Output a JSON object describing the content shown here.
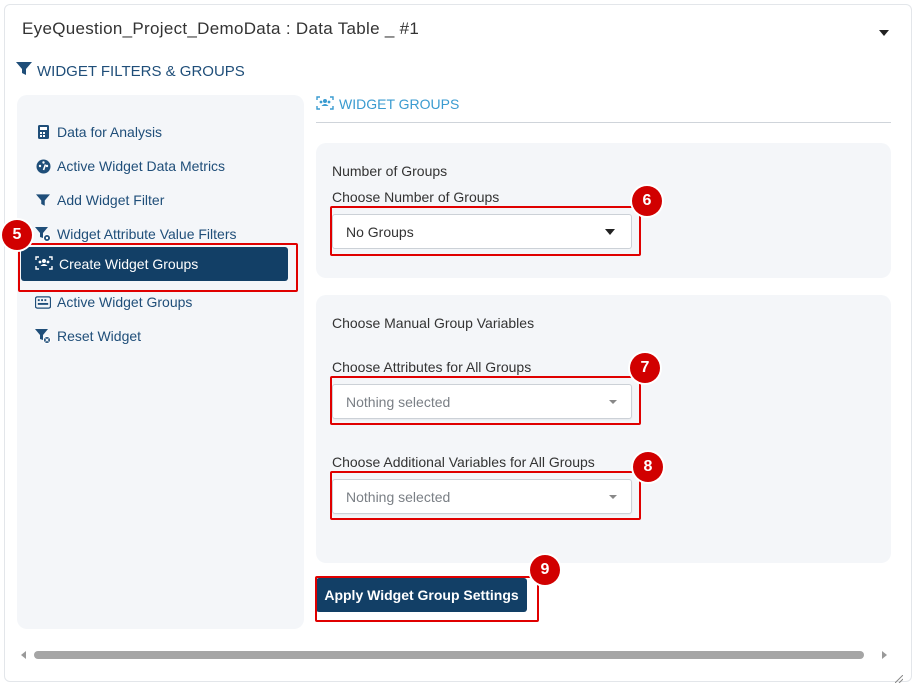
{
  "panel": {
    "title": "EyeQuestion_Project_DemoData : Data Table _ #1"
  },
  "filters_section": {
    "heading": "WIDGET FILTERS & GROUPS",
    "icon": "filter-icon"
  },
  "sidebar": {
    "items": [
      {
        "label": "Data for Analysis",
        "icon": "calculator-icon"
      },
      {
        "label": "Active Widget Data Metrics",
        "icon": "gauge-icon"
      },
      {
        "label": "Add Widget Filter",
        "icon": "filter-icon"
      },
      {
        "label": "Widget Attribute Value Filters",
        "icon": "filter-gear-icon"
      },
      {
        "label": "Create Widget Groups",
        "icon": "users-icon",
        "active": true
      },
      {
        "label": "Active Widget Groups",
        "icon": "keyboard-icon"
      },
      {
        "label": "Reset Widget",
        "icon": "filter-reset-icon"
      }
    ]
  },
  "groups_tab": {
    "label": "WIDGET GROUPS",
    "icon": "users-icon"
  },
  "number_of_groups": {
    "title": "Number of Groups",
    "field_label": "Choose Number of Groups",
    "value": "No Groups"
  },
  "manual_groups": {
    "title": "Choose Manual Group Variables",
    "attributes_label": "Choose Attributes for All Groups",
    "attributes_value": "Nothing selected",
    "additional_label": "Choose Additional Variables for All Groups",
    "additional_value": "Nothing selected"
  },
  "apply_button": {
    "label": "Apply Widget Group Settings"
  },
  "annotations": {
    "step5": "5",
    "step6": "6",
    "step7": "7",
    "step8": "8",
    "step9": "9"
  },
  "colors": {
    "brand_dark": "#123f66",
    "nav_text": "#1f4e79",
    "tab_text": "#3a9bd0",
    "highlight": "#e00000",
    "badge": "#d10000",
    "card_bg": "#f4f6f9"
  }
}
